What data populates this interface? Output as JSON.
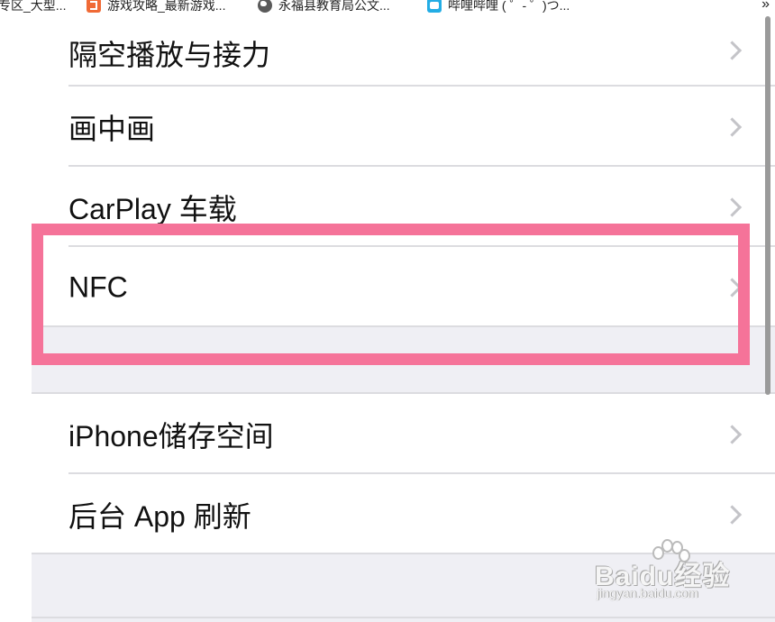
{
  "bookmarks": [
    {
      "label": "专区_大型...",
      "icon": "none"
    },
    {
      "label": "游戏攻略_最新游戏...",
      "icon": "orange-s-icon"
    },
    {
      "label": "永福县教育局公文...",
      "icon": "globe-icon"
    },
    {
      "label": "哔哩哔哩 ( ゜- ゜)つ...",
      "icon": "bilibili-icon"
    }
  ],
  "bookmarks_overflow": "»",
  "settings": {
    "rows": [
      {
        "label": "隔空播放与接力"
      },
      {
        "label": "画中画"
      },
      {
        "label": "CarPlay 车载"
      },
      {
        "label": "NFC"
      },
      {
        "label": "iPhone储存空间"
      },
      {
        "label": "后台 App 刷新"
      }
    ]
  },
  "highlight_color": "#f57399",
  "watermark": {
    "main": "Baidu经验",
    "sub": "jingyan.baidu.com"
  }
}
